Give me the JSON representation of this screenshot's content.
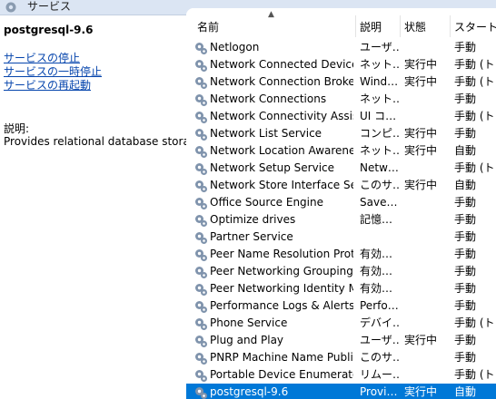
{
  "window": {
    "title": "サービス"
  },
  "left": {
    "service_name": "postgresql-9.6",
    "actions": [
      "サービスの停止",
      "サービスの一時停止",
      "サービスの再起動"
    ],
    "description_label": "説明:",
    "description_text": "Provides relational database storage."
  },
  "columns": [
    "名前",
    "説明",
    "状態",
    "スタートアップ"
  ],
  "rows": [
    {
      "name": "Netlogon",
      "desc": "ユーザ…",
      "state": "",
      "startup": "手動"
    },
    {
      "name": "Network Connected Device…",
      "desc": "ネット…",
      "state": "実行中",
      "startup": "手動 (トリ"
    },
    {
      "name": "Network Connection Broker",
      "desc": "Wind…",
      "state": "実行中",
      "startup": "手動 (トリ"
    },
    {
      "name": "Network Connections",
      "desc": "ネット…",
      "state": "",
      "startup": "手動"
    },
    {
      "name": "Network Connectivity Assist…",
      "desc": "UI コ…",
      "state": "",
      "startup": "手動 (トリ"
    },
    {
      "name": "Network List Service",
      "desc": "コンピ…",
      "state": "実行中",
      "startup": "手動"
    },
    {
      "name": "Network Location Awareness",
      "desc": "ネット…",
      "state": "実行中",
      "startup": "自動"
    },
    {
      "name": "Network Setup Service",
      "desc": "Netw…",
      "state": "",
      "startup": "手動 (トリ"
    },
    {
      "name": "Network Store Interface Ser…",
      "desc": "このサ…",
      "state": "実行中",
      "startup": "自動"
    },
    {
      "name": "Office  Source Engine",
      "desc": "Save…",
      "state": "",
      "startup": "手動"
    },
    {
      "name": "Optimize drives",
      "desc": "記憶…",
      "state": "",
      "startup": "手動"
    },
    {
      "name": "Partner Service",
      "desc": "",
      "state": "",
      "startup": "手動"
    },
    {
      "name": "Peer Name Resolution Prot…",
      "desc": "有効…",
      "state": "",
      "startup": "手動"
    },
    {
      "name": "Peer Networking Grouping",
      "desc": "有効…",
      "state": "",
      "startup": "手動"
    },
    {
      "name": "Peer Networking Identity M…",
      "desc": "有効…",
      "state": "",
      "startup": "手動"
    },
    {
      "name": "Performance Logs & Alerts",
      "desc": "Perfo…",
      "state": "",
      "startup": "手動"
    },
    {
      "name": "Phone Service",
      "desc": "デバイ…",
      "state": "",
      "startup": "手動 (トリ"
    },
    {
      "name": "Plug and Play",
      "desc": "ユーザ…",
      "state": "実行中",
      "startup": "手動"
    },
    {
      "name": "PNRP Machine Name Publi…",
      "desc": "このサ…",
      "state": "",
      "startup": "手動"
    },
    {
      "name": "Portable Device Enumerator…",
      "desc": "リムー…",
      "state": "",
      "startup": "手動 (トリ"
    },
    {
      "name": "postgresql-9.6",
      "desc": "Provi…",
      "state": "実行中",
      "startup": "自動",
      "selected": true
    }
  ],
  "icons": {
    "row_icon": "gear-icon",
    "title_icon": "services-gear-icon",
    "sort": "sort-ascending-icon"
  },
  "colors": {
    "selection": "#0078d7",
    "link": "#0645ad",
    "titlebar": "#dbe5f3"
  }
}
